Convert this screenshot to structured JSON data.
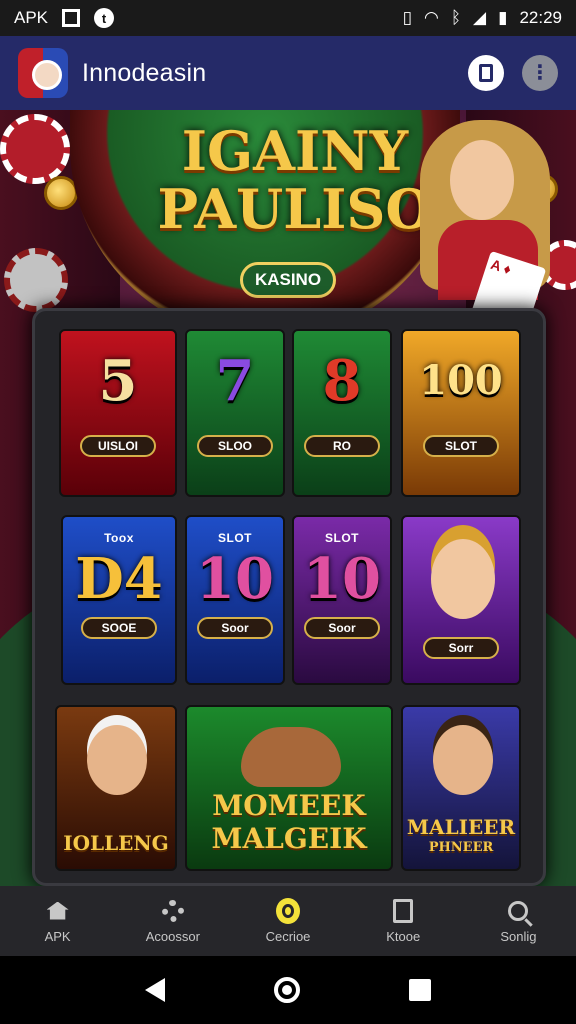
{
  "status_bar": {
    "carrier": "APK",
    "time": "22:29"
  },
  "app_bar": {
    "title": "Innodeasin"
  },
  "hero": {
    "title": "IGAINY PAULISO",
    "badge": "KASINO",
    "card_label": "A ♦"
  },
  "games": [
    {
      "big": "5",
      "label": "UISLOI",
      "colors": [
        "#c0121e",
        "#5a0008"
      ],
      "big_color": "#f6e0a0"
    },
    {
      "big": "7",
      "label": "SLOO",
      "colors": [
        "#1f8a35",
        "#0b3f18"
      ],
      "big_color": "#8a4ae0"
    },
    {
      "big": "8",
      "label": "RO",
      "colors": [
        "#1f8a35",
        "#0b3f18"
      ],
      "big_color": "#e03a28"
    },
    {
      "big": "100",
      "label": "SLOT",
      "colors": [
        "#f0a828",
        "#7a3a06"
      ],
      "big_color": "#ffe28a"
    },
    {
      "tag": "Toox",
      "big": "D4",
      "label": "SOOE",
      "colors": [
        "#1f4ec8",
        "#0b1f6a"
      ],
      "big_color": "#f6c03a"
    },
    {
      "tag": "SLOT",
      "big": "10",
      "label": "Soor",
      "colors": [
        "#1f4ec8",
        "#0b1f6a"
      ],
      "big_color": "#e050a0"
    },
    {
      "tag": "SLOT",
      "big": "10",
      "label": "Soor",
      "colors": [
        "#7a2aa8",
        "#2a0a40"
      ],
      "big_color": "#e050a0"
    },
    {
      "label": "Sorr",
      "colors": [
        "#8a3ac8",
        "#3a0a60"
      ]
    },
    {
      "caption": "IOLLENG",
      "colors": [
        "#7a3a10",
        "#2a0c04"
      ]
    },
    {
      "caption": "MOMEEK MALGEIK",
      "colors": [
        "#1c8a2c",
        "#0a3a10"
      ]
    },
    {
      "caption": "MALIEER",
      "sub": "PHNEER",
      "colors": [
        "#3a3aa8",
        "#14143a"
      ]
    }
  ],
  "bottom_nav": [
    "APK",
    "Acoossor",
    "Cecrioe",
    "Ktooe",
    "Sonlig"
  ],
  "accent": "#f3e23a"
}
